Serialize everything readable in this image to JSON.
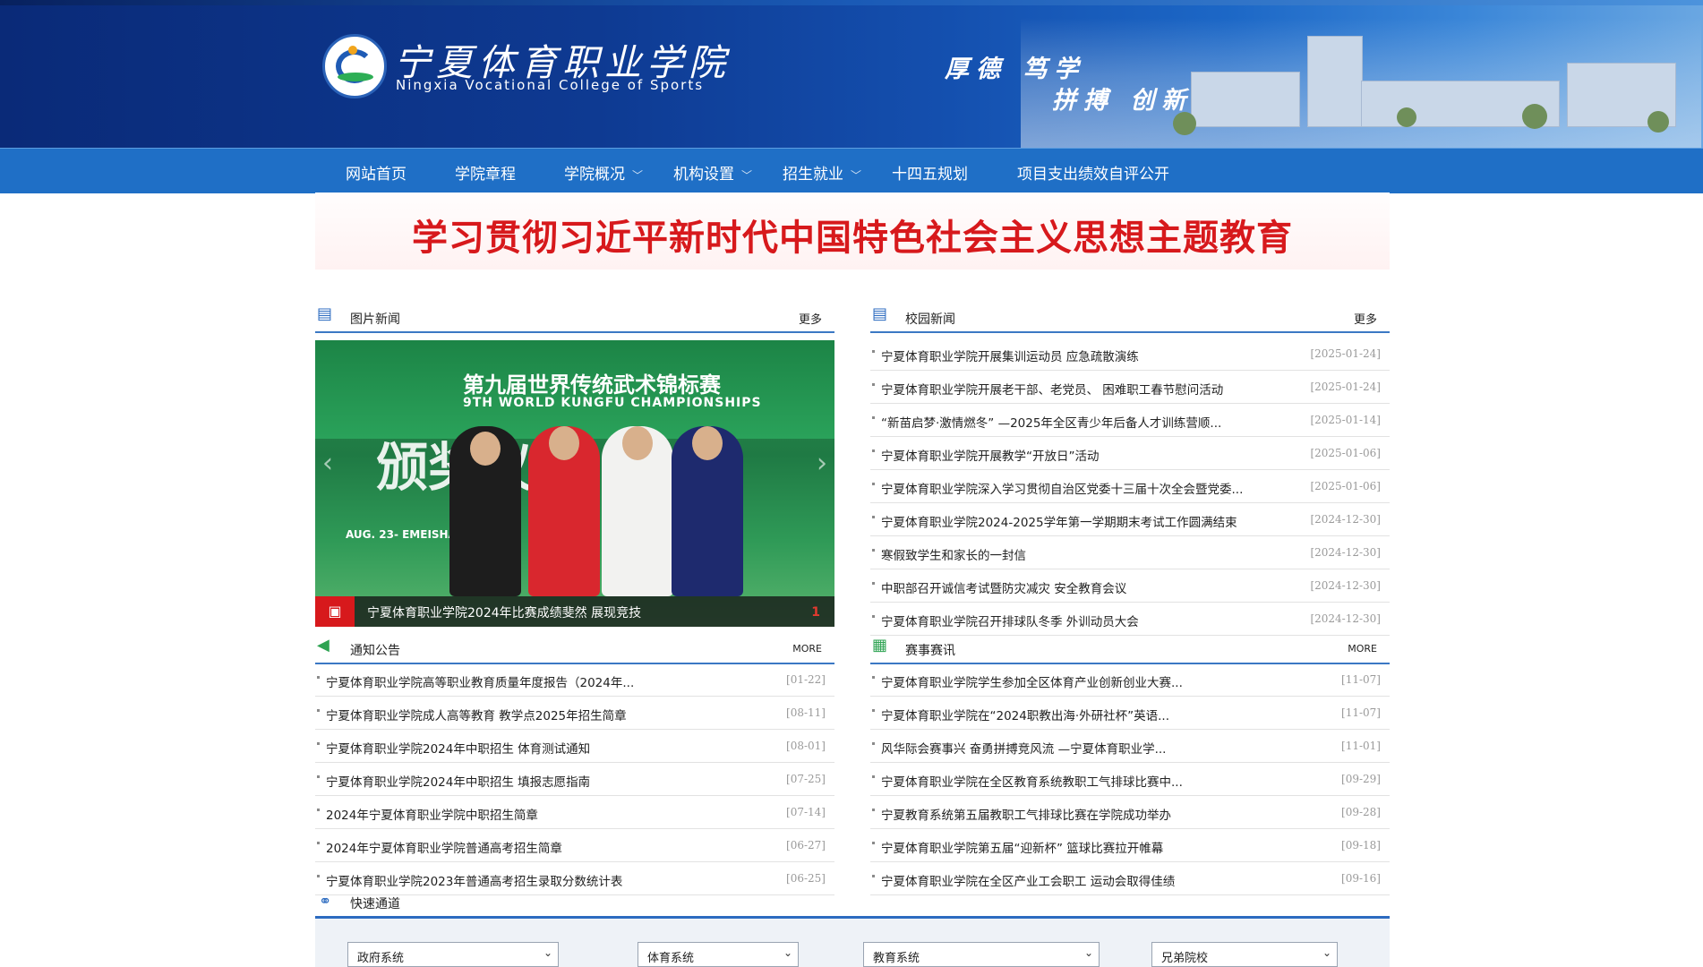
{
  "header": {
    "logo_cn": "宁夏体育职业学院",
    "logo_en": "Ningxia Vocational College of Sports",
    "motto_line1": "厚德 笃学",
    "motto_line2": "拼搏 创新"
  },
  "nav": [
    {
      "label": "网站首页",
      "dropdown": false
    },
    {
      "label": "学院章程",
      "dropdown": false
    },
    {
      "label": "学院概况",
      "dropdown": true
    },
    {
      "label": "机构设置",
      "dropdown": true
    },
    {
      "label": "招生就业",
      "dropdown": true
    },
    {
      "label": "十四五规划",
      "dropdown": false
    },
    {
      "label": "项目支出绩效自评公开",
      "dropdown": false
    }
  ],
  "banner": {
    "text": "学习贯彻习近平新时代中国特色社会主义思想主题教育"
  },
  "photo_news": {
    "title": "图片新闻",
    "more": "更多",
    "image": {
      "event_title": "第九届世界传统武术锦标赛",
      "event_en": "9TH WORLD KUNGFU CHAMPIONSHIPS",
      "big_text": "颁奖仪式",
      "venue": "AUG. 23- EMEISHAN"
    },
    "caption": "宁夏体育职业学院2024年比赛成绩斐然 展现竞技",
    "slide_number": "1"
  },
  "campus_news": {
    "title": "校园新闻",
    "more": "更多",
    "items": [
      {
        "title": "宁夏体育职业学院开展集训运动员 应急疏散演练",
        "date": "[2025-01-24]"
      },
      {
        "title": "宁夏体育职业学院开展老干部、老党员、 困难职工春节慰问活动",
        "date": "[2025-01-24]"
      },
      {
        "title": "“新苗启梦·激情燃冬” —2025年全区青少年后备人才训练营顺...",
        "date": "[2025-01-14]"
      },
      {
        "title": "宁夏体育职业学院开展教学“开放日”活动",
        "date": "[2025-01-06]"
      },
      {
        "title": "宁夏体育职业学院深入学习贯彻自治区党委十三届十次全会暨党委...",
        "date": "[2025-01-06]"
      },
      {
        "title": "宁夏体育职业学院2024-2025学年第一学期期末考试工作圆满结束",
        "date": "[2024-12-30]"
      },
      {
        "title": "寒假致学生和家长的一封信",
        "date": "[2024-12-30]"
      },
      {
        "title": "中职部召开诚信考试暨防灾减灾 安全教育会议",
        "date": "[2024-12-30]"
      },
      {
        "title": "宁夏体育职业学院召开排球队冬季 外训动员大会",
        "date": "[2024-12-30]"
      }
    ]
  },
  "notices": {
    "title": "通知公告",
    "more": "MORE",
    "items": [
      {
        "title": "宁夏体育职业学院高等职业教育质量年度报告（2024年...",
        "date": "[01-22]"
      },
      {
        "title": "宁夏体育职业学院成人高等教育 教学点2025年招生简章",
        "date": "[08-11]"
      },
      {
        "title": "宁夏体育职业学院2024年中职招生 体育测试通知",
        "date": "[08-01]"
      },
      {
        "title": "宁夏体育职业学院2024年中职招生 填报志愿指南",
        "date": "[07-25]"
      },
      {
        "title": "2024年宁夏体育职业学院中职招生简章",
        "date": "[07-14]"
      },
      {
        "title": "2024年宁夏体育职业学院普通高考招生简章",
        "date": "[06-27]"
      },
      {
        "title": "宁夏体育职业学院2023年普通高考招生录取分数统计表",
        "date": "[06-25]"
      }
    ]
  },
  "events": {
    "title": "赛事赛讯",
    "more": "MORE",
    "items": [
      {
        "title": "宁夏体育职业学院学生参加全区体育产业创新创业大赛...",
        "date": "[11-07]"
      },
      {
        "title": "宁夏体育职业学院在“2024职教出海·外研社杯”英语...",
        "date": "[11-07]"
      },
      {
        "title": "风华际会赛事兴 奋勇拼搏竞风流 —宁夏体育职业学...",
        "date": "[11-01]"
      },
      {
        "title": "宁夏体育职业学院在全区教育系统教职工气排球比赛中...",
        "date": "[09-29]"
      },
      {
        "title": "宁夏教育系统第五届教职工气排球比赛在学院成功举办",
        "date": "[09-28]"
      },
      {
        "title": "宁夏体育职业学院第五届“迎新杯” 篮球比赛拉开帷幕",
        "date": "[09-18]"
      },
      {
        "title": "宁夏体育职业学院在全区产业工会职工 运动会取得佳绩",
        "date": "[09-16]"
      }
    ]
  },
  "quick_links": {
    "title": "快速通道",
    "selects": [
      {
        "value": "政府系统"
      },
      {
        "value": "体育系统"
      },
      {
        "value": "教育系统"
      },
      {
        "value": "兄弟院校"
      }
    ]
  },
  "colors": {
    "header_dark": "#0a2a78",
    "nav_blue": "#1f6fc6",
    "banner_red": "#d7191c",
    "section_line": "#3b78c4"
  }
}
